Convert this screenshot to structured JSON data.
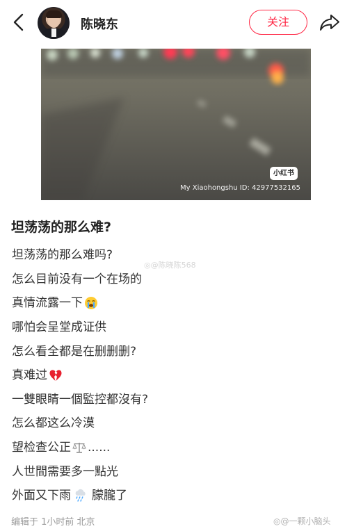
{
  "header": {
    "username": "陈晓东",
    "follow_label": "关注",
    "icons": {
      "back": "chevron-left-icon",
      "share": "share-arrow-icon"
    },
    "accent_color": "#ff2442"
  },
  "media": {
    "watermark_logo_text": "小红书",
    "watermark_id_text": "My Xiaohongshu ID: 42977532165"
  },
  "post": {
    "title": "坦荡荡的那么难?",
    "lines": [
      {
        "text": "坦荡荡的那么难吗?"
      },
      {
        "text": "怎么目前没有一个在场的"
      },
      {
        "text": "真情流露一下",
        "emoji": "crying-face-emoji"
      },
      {
        "text": "哪怕会呈堂成证供"
      },
      {
        "text": "怎么看全都是在删删删?"
      },
      {
        "text": "真难过",
        "emoji": "broken-heart-emoji"
      },
      {
        "text": "一雙眼睛一個監控都沒有?"
      },
      {
        "text": "怎么都这么冷漠"
      },
      {
        "text": "望检查公正",
        "emoji": "scales-emoji",
        "suffix": "......"
      },
      {
        "text": "人世間需要多一點光"
      },
      {
        "text": "外面又下雨",
        "emoji": "rain-cloud-emoji",
        "suffix": "朦朧了"
      }
    ],
    "meta": "编辑于 1小时前 北京"
  },
  "watermarks": {
    "middle": "@陈晓陈568",
    "bottom": "@一颗小脑头"
  }
}
